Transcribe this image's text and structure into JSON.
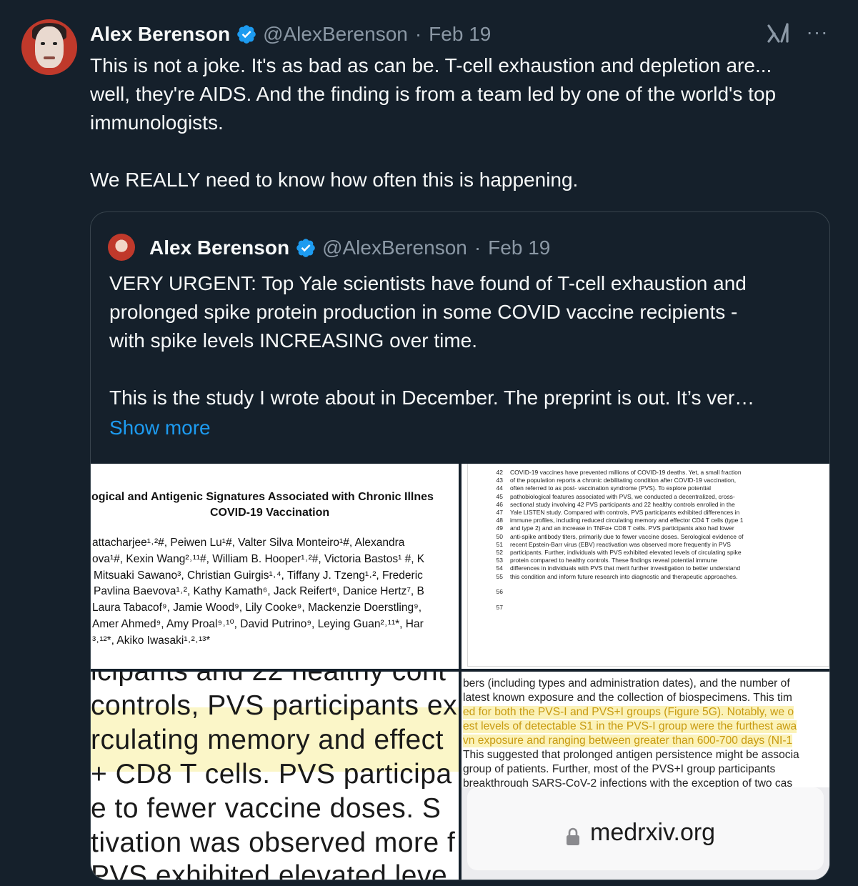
{
  "tweet": {
    "author_name": "Alex Berenson",
    "handle": "@AlexBerenson",
    "separator": "·",
    "date": "Feb 19",
    "more_label": "···",
    "paragraphs": [
      "This is not a joke. It's as bad as can be. T-cell exhaustion and depletion are... well, they're AIDS. And the finding is from a team led by one of the world's top immunologists.",
      "We REALLY need to know how often this is happening."
    ]
  },
  "quoted_tweet": {
    "author_name": "Alex Berenson",
    "handle": "@AlexBerenson",
    "separator": "·",
    "date": "Feb 19",
    "lines": [
      "VERY URGENT: Top Yale scientists have found of T-cell exhaustion and",
      "prolonged spike protein production in some COVID vaccine recipients -",
      "with spike levels INCREASING over time."
    ],
    "line2": "This is the study I wrote about in December. The preprint is out. It’s ver…",
    "show_more": "Show more"
  },
  "media": {
    "image1": {
      "title_lines": [
        "ogical and Antigenic Signatures Associated with Chronic Illnes",
        "COVID-19 Vaccination"
      ],
      "author_lines": [
        "attacharjee¹˒²#, Peiwen Lu¹#, Valter Silva Monteiro¹#, Alexandra",
        "ova¹#, Kexin Wang²˒¹¹#, William B. Hooper¹˒²#, Victoria Bastos¹ #, K",
        "Mitsuaki Sawano³, Christian Guirgis¹˒⁴, Tiffany J. Tzeng¹˒², Frederic",
        "Pavlina Baevova¹˒², Kathy Kamath⁶, Jack Reifert⁶, Danice Hertz⁷, B",
        "Laura Tabacof⁹, Jamie Wood⁹, Lily Cooke⁹, Mackenzie Doerstling⁹,",
        "Amer Ahmed⁹, Amy Proal⁹˒¹⁰, David Putrino⁹, Leying Guan²˒¹¹*, Har",
        "³˒¹²*, Akiko Iwasaki¹˒²˒¹³*"
      ]
    },
    "image2": {
      "line_numbers": [
        "42",
        "43",
        "44",
        "45",
        "46",
        "47",
        "48",
        "49",
        "50",
        "51",
        "52",
        "53",
        "54",
        "55"
      ],
      "abstract_lines": [
        "COVID-19 vaccines have prevented millions of COVID-19 deaths. Yet, a small fraction",
        "of the population reports a chronic debilitating condition after COVID-19 vaccination,",
        "often referred to as post- vaccination syndrome (PVS). To explore potential",
        "pathobiological features associated with PVS, we conducted a decentralized, cross-",
        "sectional study involving 42 PVS participants and 22 healthy controls enrolled in the",
        "Yale LISTEN study. Compared with controls, PVS participants exhibited differences in",
        "immune profiles, including reduced circulating memory and effector CD4 T cells (type 1",
        "and type 2) and an increase in TNFα+ CD8 T cells. PVS participants also had lower",
        "anti-spike antibody titers, primarily due to fewer vaccine doses. Serological evidence of",
        "recent Epstein-Barr virus (EBV) reactivation was observed more frequently in PVS",
        "participants. Further, individuals with PVS exhibited elevated levels of circulating spike",
        "protein compared to healthy controls. These findings reveal potential immune",
        "differences in individuals with PVS that merit further investigation to better understand",
        "this condition and inform future research into diagnostic and therapeutic approaches."
      ],
      "extra_line_numbers": [
        "56",
        "57"
      ]
    },
    "image3": {
      "lines": [
        "icipants and 22 healthy cont",
        "controls, PVS participants ex",
        "rculating memory and effect",
        "+ CD8 T cells. PVS participa",
        "e to fewer vaccine doses. S",
        "tivation was observed more f",
        "PVS exhibited elevated leve"
      ]
    },
    "image4": {
      "lines": [
        "bers (including types and administration dates), and the number of",
        "latest known exposure and the collection of biospecimens. This tim",
        "ed for both the PVS-I and PVS+I groups (Figure 5G). Notably, we o",
        "est levels of detectable S1 in the PVS-I group were the furthest awa",
        "vn exposure and ranging between greater than 600-700 days (NI-1",
        "This suggested that prolonged antigen persistence might be associa",
        "group of patients. Further, most of the PVS+I group participants",
        "breakthrough SARS-CoV-2 infections with the exception of two cas"
      ],
      "url": "medrxiv.org"
    }
  },
  "colors": {
    "background": "#15202b",
    "text": "#f7f9f9",
    "secondary": "#8b98a5",
    "link": "#1d9bf0",
    "verified": "#1d9bf0",
    "border": "#38444d"
  },
  "icons": [
    "verified-badge-icon",
    "grok-icon",
    "more-options-icon",
    "lock-icon"
  ]
}
